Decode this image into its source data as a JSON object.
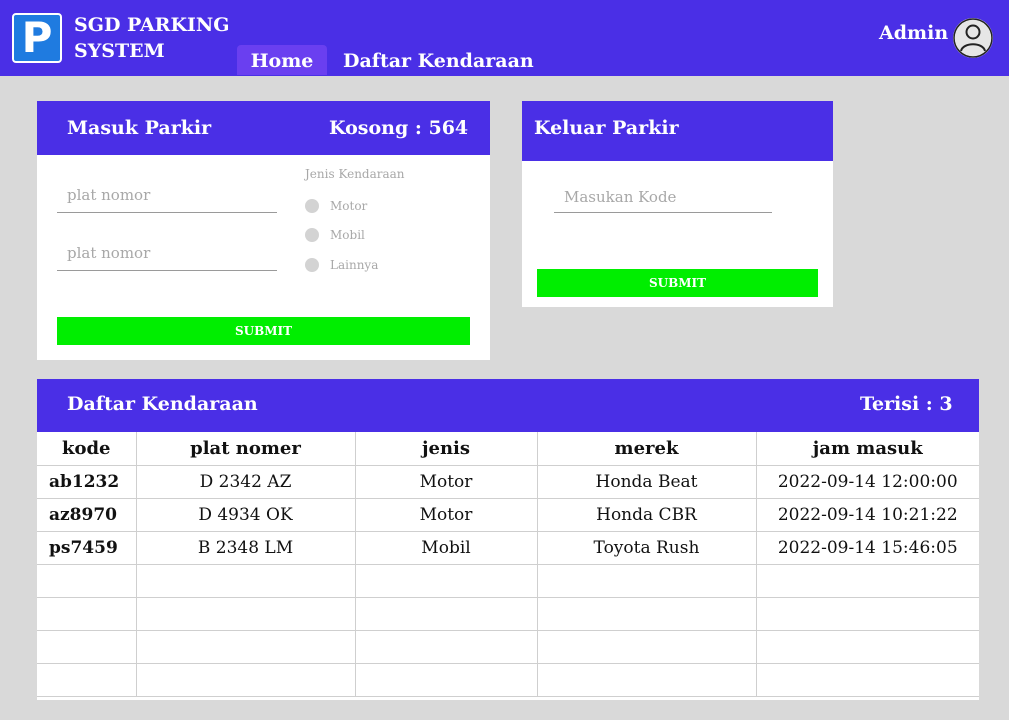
{
  "app": {
    "logo_letter": "P",
    "title_line1": "SGD PARKING",
    "title_line2": "SYSTEM"
  },
  "nav": {
    "items": [
      {
        "label": "Home",
        "active": true
      },
      {
        "label": "Daftar Kendaraan",
        "active": false
      }
    ]
  },
  "user": {
    "label": "Admin",
    "avatar_icon": "user-icon"
  },
  "masuk": {
    "title": "Masuk Parkir",
    "kosong": "Kosong : 564",
    "plat1_placeholder": "plat nomor",
    "plat2_placeholder": "plat nomor",
    "jenis_label": "Jenis Kendaraan",
    "options": [
      "Motor",
      "Mobil",
      "Lainnya"
    ],
    "submit": "SUBMIT"
  },
  "keluar": {
    "title": "Keluar Parkir",
    "kode_placeholder": "Masukan Kode",
    "submit": "SUBMIT"
  },
  "daftar": {
    "title": "Daftar Kendaraan",
    "terisi": "Terisi : 3",
    "columns": [
      "kode",
      "plat nomer",
      "jenis",
      "merek",
      "jam masuk"
    ],
    "rows": [
      [
        "ab1232",
        "D 2342 AZ",
        "Motor",
        "Honda Beat",
        "2022-09-14 12:00:00"
      ],
      [
        "az8970",
        "D 4934 OK",
        "Motor",
        "Honda CBR",
        "2022-09-14 10:21:22"
      ],
      [
        "ps7459",
        "B 2348 LM",
        "Mobil",
        "Toyota Rush",
        "2022-09-14 15:46:05"
      ]
    ],
    "empty_rows": 4
  },
  "colors": {
    "accent": "#4a2fe6",
    "submit": "#00ee00",
    "background": "#d9d9d9"
  }
}
